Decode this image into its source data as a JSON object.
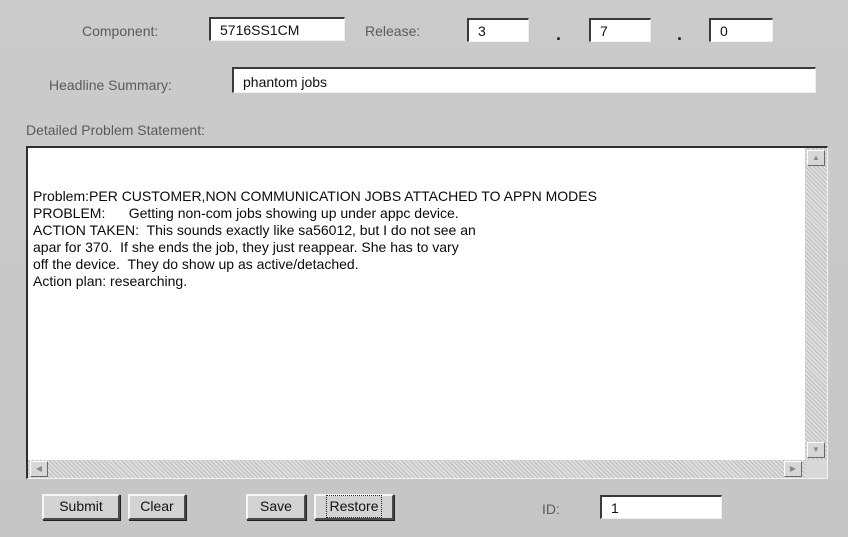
{
  "header": {
    "component_label": "Component:",
    "component_value": "5716SS1CM",
    "release_label": "Release:",
    "release_major": "3",
    "release_minor": "7",
    "release_patch": "0",
    "separator": "."
  },
  "headline": {
    "label": "Headline Summary:",
    "value": "phantom jobs"
  },
  "problem": {
    "label": "Detailed Problem Statement:",
    "text": "Problem:PER CUSTOMER,NON COMMUNICATION JOBS ATTACHED TO APPN MODES\nPROBLEM:      Getting non-com jobs showing up under appc device.\nACTION TAKEN:  This sounds exactly like sa56012, but I do not see an\napar for 370.  If she ends the job, they just reappear. She has to vary\noff the device.  They do show up as active/detached.\nAction plan: researching."
  },
  "buttons": {
    "submit": "Submit",
    "clear": "Clear",
    "save": "Save",
    "restore": "Restore"
  },
  "id_field": {
    "label": "ID:",
    "value": "1"
  },
  "icons": {
    "scroll_up": "scroll-up-arrow-icon",
    "scroll_down": "scroll-down-arrow-icon",
    "scroll_left": "scroll-left-arrow-icon",
    "scroll_right": "scroll-right-arrow-icon"
  }
}
